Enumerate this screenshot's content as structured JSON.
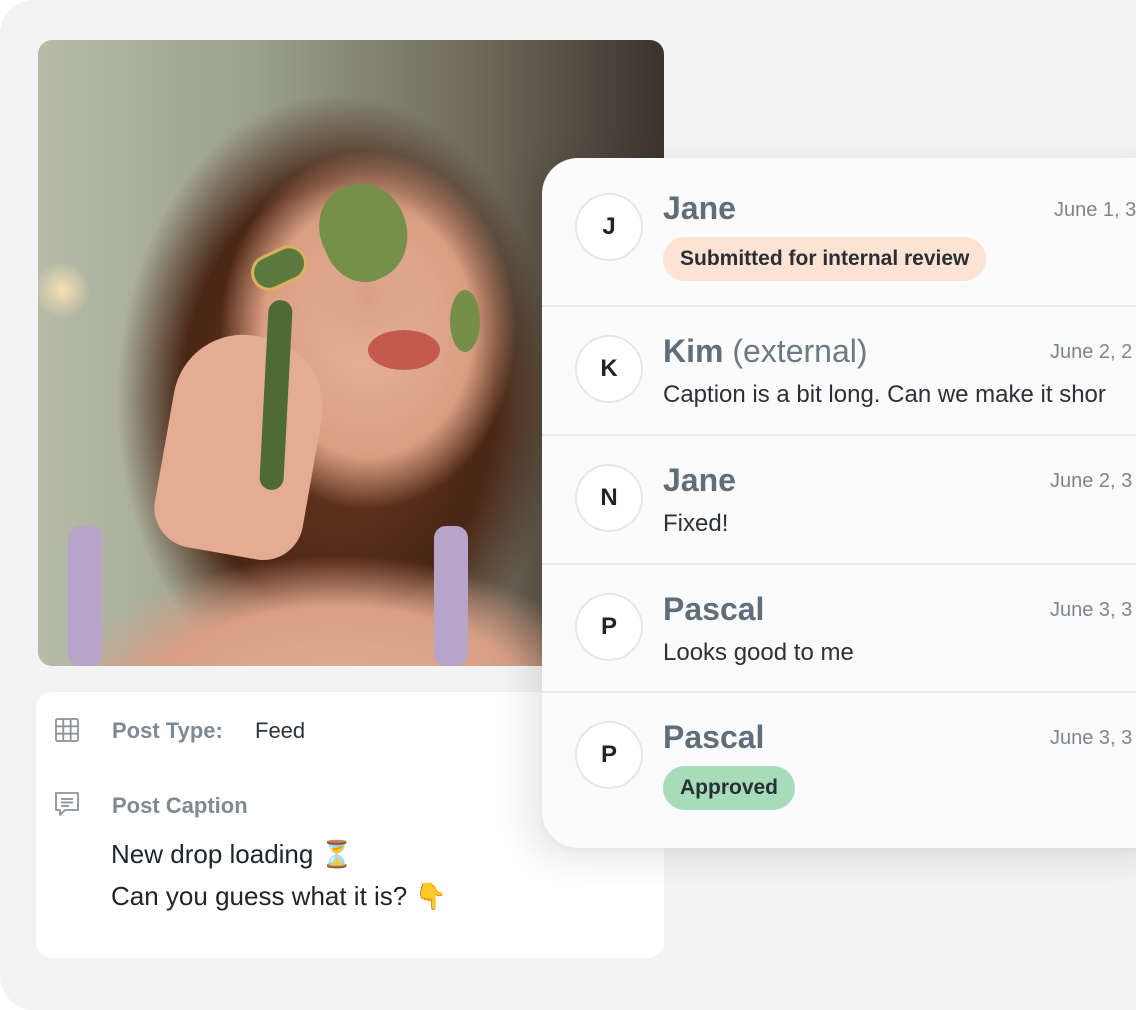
{
  "post": {
    "type_label": "Post Type:",
    "type_value": "Feed",
    "caption_label": "Post Caption",
    "caption_lines": [
      "New drop loading ⏳",
      "Can you guess what it is? 👇"
    ]
  },
  "comments": [
    {
      "initial": "J",
      "name": "Jane",
      "tag": "",
      "date": "June 1, 3",
      "badge": "Submitted for internal review",
      "badge_color": "#fde3d4",
      "message": ""
    },
    {
      "initial": "K",
      "name": "Kim",
      "tag": "(external)",
      "date": "June 2, 2",
      "badge": "",
      "message": "Caption is a bit long. Can we make it shor"
    },
    {
      "initial": "N",
      "name": "Jane",
      "tag": "",
      "date": "June 2, 3",
      "badge": "",
      "message": "Fixed!"
    },
    {
      "initial": "P",
      "name": "Pascal",
      "tag": "",
      "date": "June 3, 3",
      "badge": "",
      "message": "Looks good to me"
    },
    {
      "initial": "P",
      "name": "Pascal",
      "tag": "",
      "date": "June 3, 3",
      "badge": "Approved",
      "badge_color": "#a7dcbb",
      "message": ""
    }
  ],
  "icons": {
    "post_type": "grid-icon",
    "post_caption": "chat-lines-icon"
  },
  "colors": {
    "background": "#f3f3f3",
    "name": "#5f6e79",
    "label": "#7e8a93"
  }
}
